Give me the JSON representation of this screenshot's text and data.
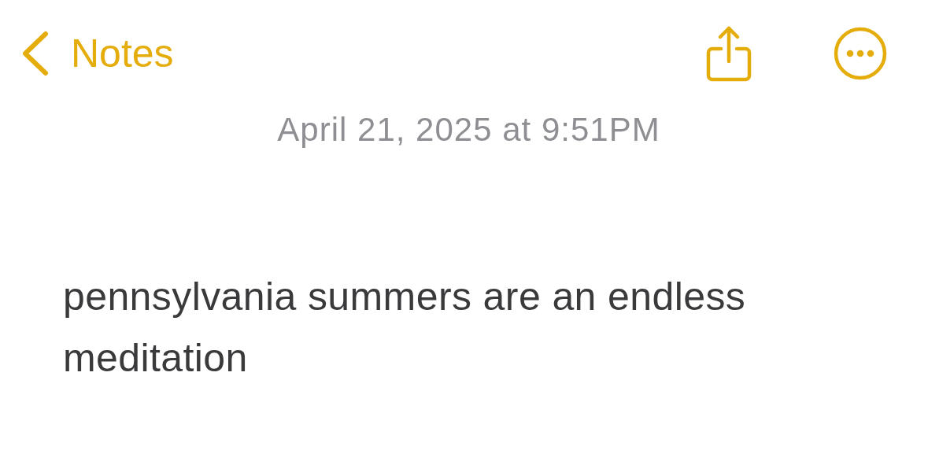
{
  "nav": {
    "back_label": "Notes"
  },
  "note": {
    "date": "April 21, 2025 at 9:51PM",
    "body": "pennsylvania summers are an endless meditation"
  }
}
